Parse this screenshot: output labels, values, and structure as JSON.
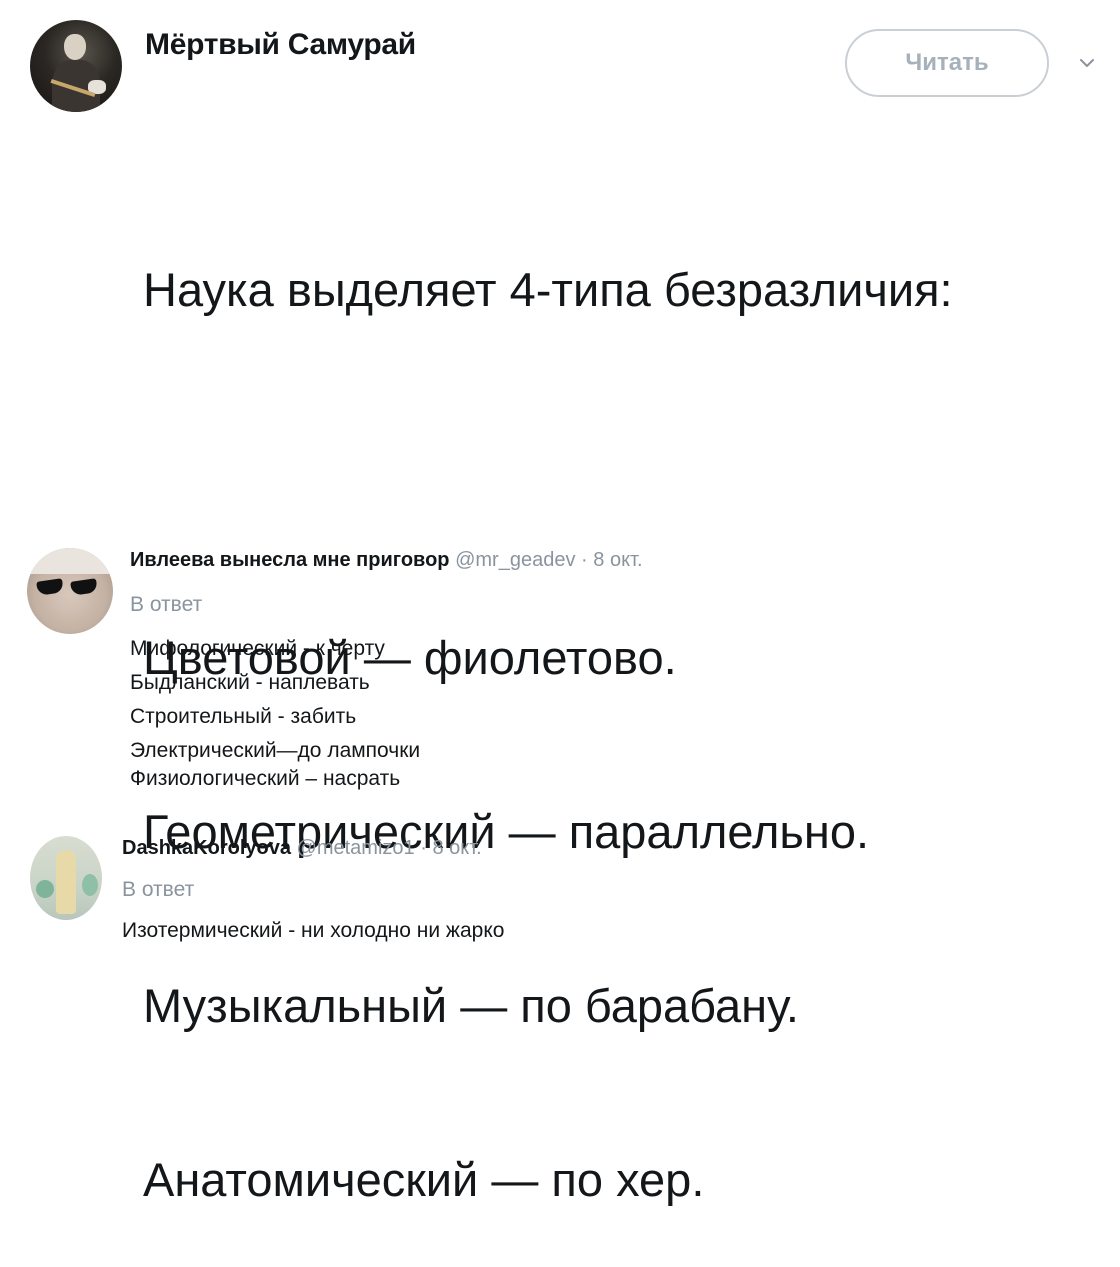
{
  "tweet": {
    "author": "Мёртвый Самурай",
    "follow_label": "Читать",
    "lines": [
      "Наука выделяет 4-типа безразличия:",
      "Цветовой — фиолетово.",
      "Геометрический — параллельно.",
      "Музыкальный — по барабану.",
      "Анатомический — по хер."
    ]
  },
  "replies": [
    {
      "name": "Ивлеева вынесла мне приговор",
      "handle": "@mr_geadev",
      "separator": "·",
      "date": "8 окт.",
      "reply_label": "В ответ",
      "lines": [
        "Мифологический - к черту",
        "Быдланский - наплевать",
        "Строительный - забить",
        "Электрический—до лампочки",
        "Физиологический – насрать"
      ]
    },
    {
      "name": "DashkaKorolyova",
      "handle": "@metamizo1",
      "separator": "·",
      "date": "8 окт.",
      "reply_label": "В ответ",
      "lines": [
        "Изотермический - ни холодно ни жарко"
      ]
    }
  ],
  "icons": {
    "more": "chevron-down-icon"
  },
  "colors": {
    "text": "#14171a",
    "muted": "#8a949e",
    "button_border": "#c9cfd5",
    "button_text": "#a7b1bb"
  }
}
